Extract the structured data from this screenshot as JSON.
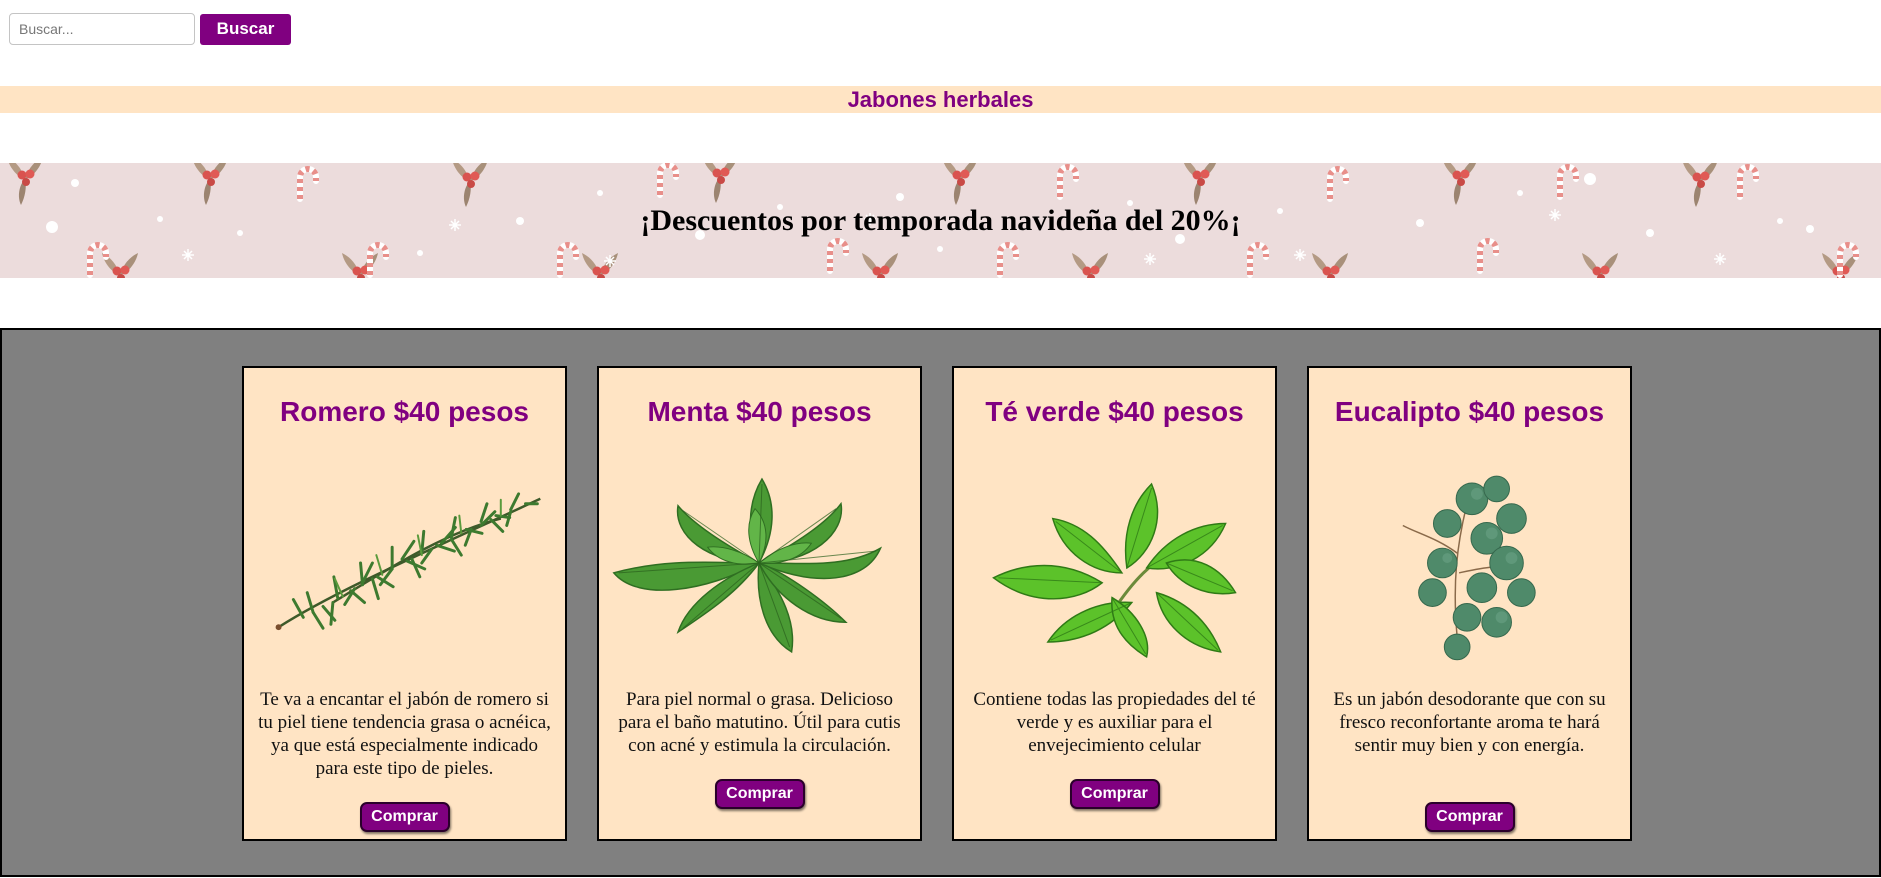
{
  "search": {
    "placeholder": "Buscar...",
    "value": "",
    "button_label": "Buscar"
  },
  "section": {
    "title": "Jabones herbales"
  },
  "promo": {
    "text": "¡Descuentos por temporada navideña del 20%¡"
  },
  "colors": {
    "accent": "#800080",
    "card_bg": "#ffe4c4",
    "panel_bg": "#808080",
    "promo_bg": "#ecdcdc"
  },
  "products": [
    {
      "title": "Romero $40 pesos",
      "image": "rosemary-sprig",
      "description": "Te va a encantar el jabón de romero si tu piel tiene tendencia grasa o acnéica, ya que está especialmente indicado para este tipo de pieles.",
      "button_label": "Comprar"
    },
    {
      "title": "Menta $40 pesos",
      "image": "mint-leaves",
      "description": "Para piel normal o grasa. Delicioso para el baño matutino. Útil para cutis con acné y estimula la circulación.",
      "button_label": "Comprar"
    },
    {
      "title": "Té verde $40 pesos",
      "image": "green-tea-leaves",
      "description": "Contiene todas las propiedades del té verde y es auxiliar para el envejecimiento celular",
      "button_label": "Comprar"
    },
    {
      "title": "Eucalipto $40 pesos",
      "image": "eucalyptus-branch",
      "description": "Es un jabón desodorante que con su fresco reconfortante aroma te hará sentir muy bien y con energía.",
      "button_label": "Comprar"
    }
  ]
}
